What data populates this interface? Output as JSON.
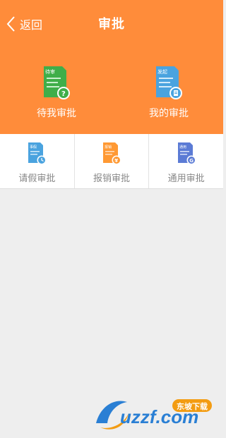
{
  "header": {
    "back_label": "返回",
    "title": "审批",
    "items": [
      {
        "label": "待我审批",
        "badge": "待审",
        "icon": "pending-approval-icon",
        "color": "#3fae49"
      },
      {
        "label": "我的审批",
        "badge": "发起",
        "icon": "my-approval-icon",
        "color": "#4aa3df"
      }
    ]
  },
  "categories": [
    {
      "label": "请假审批",
      "badge": "事假",
      "icon": "leave-approval-icon",
      "color": "#4aa3df"
    },
    {
      "label": "报销审批",
      "badge": "报销",
      "icon": "expense-approval-icon",
      "color": "#ff9933"
    },
    {
      "label": "通用审批",
      "badge": "通用",
      "icon": "general-approval-icon",
      "color": "#5b7bd5"
    }
  ],
  "watermark": {
    "brand": "uzzf.com",
    "tag": "东坡下载"
  },
  "colors": {
    "header_bg": "#ff8c3a",
    "page_bg": "#eeeeee"
  }
}
